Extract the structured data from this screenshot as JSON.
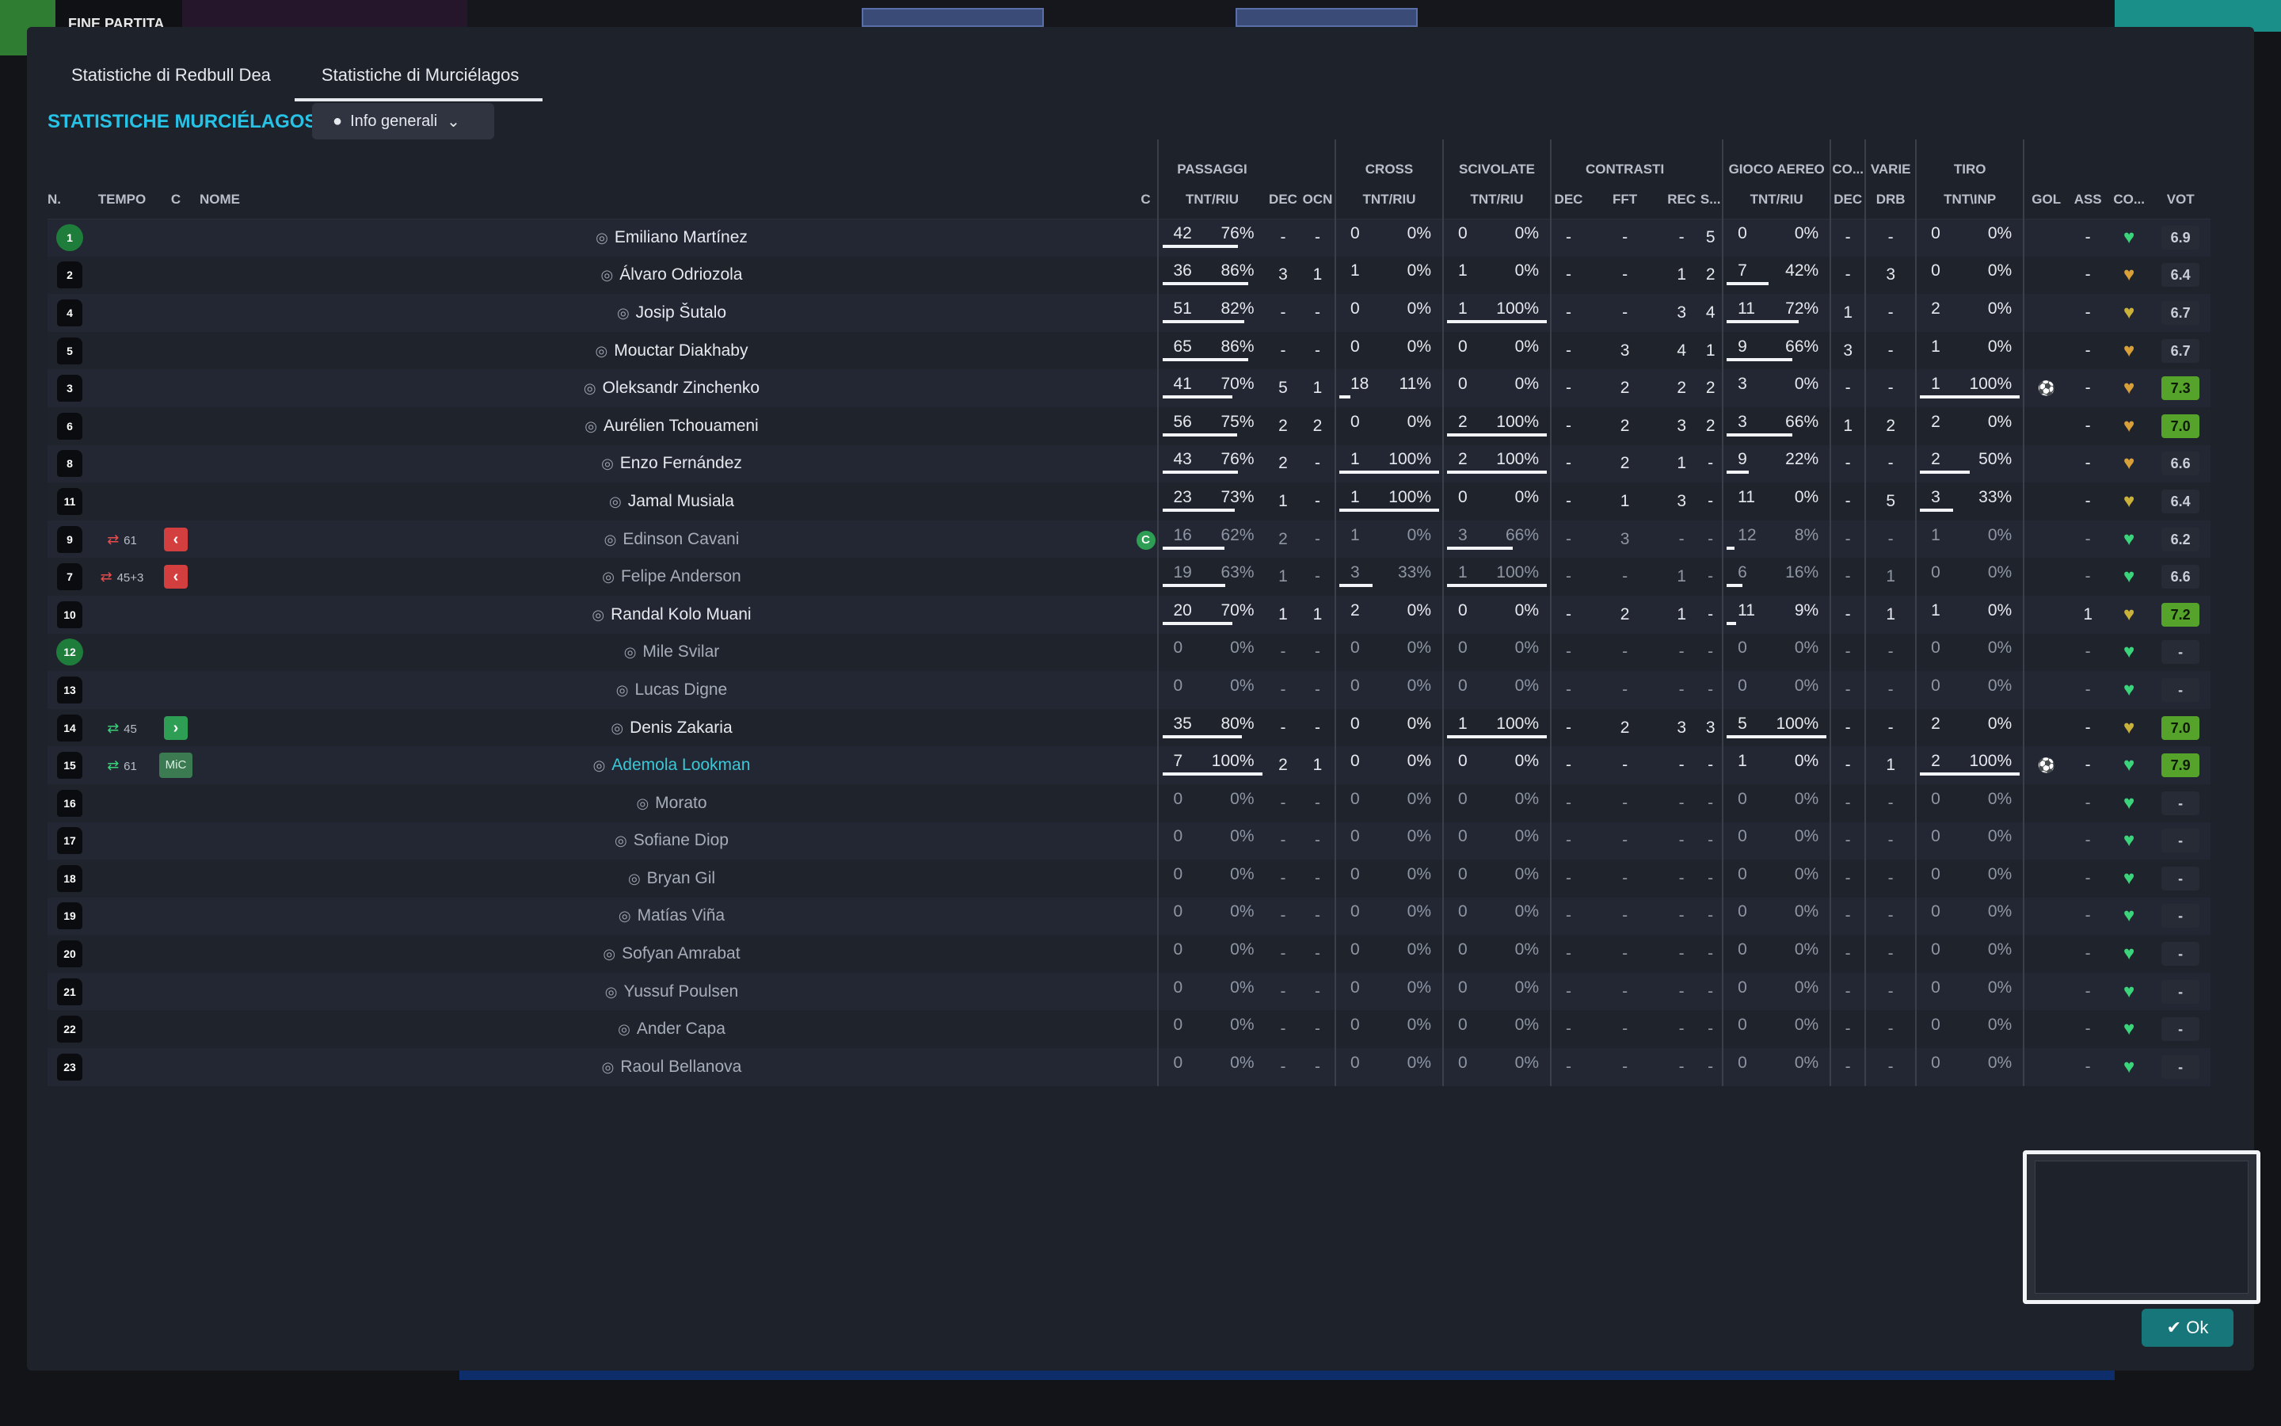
{
  "topbar": {
    "fine_partita": "FINE PARTITA"
  },
  "dialog": {
    "tabs": [
      "Statistiche di Redbull Dea",
      "Statistiche di Murciélagos"
    ],
    "title": "STATISTICHE MURCIÉLAGOS",
    "view": "Info generali",
    "ok": "Ok"
  },
  "groups": [
    "PASSAGGI",
    "CROSS",
    "SCIVOLATE",
    "CONTRASTI",
    "GIOCO AEREO",
    "CO...",
    "VARIE",
    "TIRO"
  ],
  "cols": [
    "N.",
    "TEMPO",
    "C",
    "NOME",
    "C",
    "TNT/RIU",
    "DEC",
    "OCN",
    "TNT/RIU",
    "TNT/RIU",
    "DEC",
    "FFT",
    "REC",
    "S...",
    "TNT/RIU",
    "DEC",
    "DRB",
    "TNT\\INP",
    "GOL",
    "ASS",
    "CO...",
    "VOT"
  ],
  "players": [
    {
      "n": "1",
      "gk": true,
      "name": "Emiliano Martínez",
      "pas": [
        "42",
        "76%",
        0.76
      ],
      "dec": "-",
      "ocn": "-",
      "cross": [
        "0",
        "0%",
        0
      ],
      "sciv": [
        "0",
        "0%",
        0
      ],
      "ct": [
        "-",
        "-",
        "-",
        "5"
      ],
      "aereo": [
        "0",
        "0%",
        0
      ],
      "co": "-",
      "drb": "-",
      "tiro": [
        "0",
        "0%",
        0
      ],
      "gol": "",
      "ass": "-",
      "cond": "g",
      "vot": "6.9",
      "vg": false
    },
    {
      "n": "2",
      "name": "Álvaro Odriozola",
      "pas": [
        "36",
        "86%",
        0.86
      ],
      "dec": "3",
      "ocn": "1",
      "cross": [
        "1",
        "0%",
        0
      ],
      "sciv": [
        "1",
        "0%",
        0
      ],
      "ct": [
        "-",
        "-",
        "1",
        "2"
      ],
      "aereo": [
        "7",
        "42%",
        0.42
      ],
      "co": "-",
      "drb": "3",
      "tiro": [
        "0",
        "0%",
        0
      ],
      "gol": "",
      "ass": "-",
      "cond": "o",
      "vot": "6.4",
      "vg": false
    },
    {
      "n": "4",
      "name": "Josip Šutalo",
      "pas": [
        "51",
        "82%",
        0.82
      ],
      "dec": "-",
      "ocn": "-",
      "cross": [
        "0",
        "0%",
        0
      ],
      "sciv": [
        "1",
        "100%",
        1
      ],
      "ct": [
        "-",
        "-",
        "3",
        "4"
      ],
      "aereo": [
        "11",
        "72%",
        0.72
      ],
      "co": "1",
      "drb": "-",
      "tiro": [
        "2",
        "0%",
        0
      ],
      "gol": "",
      "ass": "-",
      "cond": "y",
      "vot": "6.7",
      "vg": false
    },
    {
      "n": "5",
      "name": "Mouctar Diakhaby",
      "pas": [
        "65",
        "86%",
        0.86
      ],
      "dec": "-",
      "ocn": "-",
      "cross": [
        "0",
        "0%",
        0
      ],
      "sciv": [
        "0",
        "0%",
        0
      ],
      "ct": [
        "-",
        "3",
        "4",
        "1"
      ],
      "aereo": [
        "9",
        "66%",
        0.66
      ],
      "co": "3",
      "drb": "-",
      "tiro": [
        "1",
        "0%",
        0
      ],
      "gol": "",
      "ass": "-",
      "cond": "o",
      "vot": "6.7",
      "vg": false
    },
    {
      "n": "3",
      "name": "Oleksandr Zinchenko",
      "pas": [
        "41",
        "70%",
        0.7
      ],
      "dec": "5",
      "ocn": "1",
      "cross": [
        "18",
        "11%",
        0.11
      ],
      "sciv": [
        "0",
        "0%",
        0
      ],
      "ct": [
        "-",
        "2",
        "2",
        "2"
      ],
      "aereo": [
        "3",
        "0%",
        0
      ],
      "co": "-",
      "drb": "-",
      "tiro": [
        "1",
        "100%",
        1
      ],
      "gol": "⚽",
      "ass": "-",
      "cond": "o",
      "vot": "7.3",
      "vg": true
    },
    {
      "n": "6",
      "name": "Aurélien Tchouameni",
      "pas": [
        "56",
        "75%",
        0.75
      ],
      "dec": "2",
      "ocn": "2",
      "cross": [
        "0",
        "0%",
        0
      ],
      "sciv": [
        "2",
        "100%",
        1
      ],
      "ct": [
        "-",
        "2",
        "3",
        "2"
      ],
      "aereo": [
        "3",
        "66%",
        0.66
      ],
      "co": "1",
      "drb": "2",
      "tiro": [
        "2",
        "0%",
        0
      ],
      "gol": "",
      "ass": "-",
      "cond": "o",
      "vot": "7.0",
      "vg": true
    },
    {
      "n": "8",
      "name": "Enzo Fernández",
      "pas": [
        "43",
        "76%",
        0.76
      ],
      "dec": "2",
      "ocn": "-",
      "cross": [
        "1",
        "100%",
        1
      ],
      "sciv": [
        "2",
        "100%",
        1
      ],
      "ct": [
        "-",
        "2",
        "1",
        "-"
      ],
      "aereo": [
        "9",
        "22%",
        0.22
      ],
      "co": "-",
      "drb": "-",
      "tiro": [
        "2",
        "50%",
        0.5
      ],
      "gol": "",
      "ass": "-",
      "cond": "o",
      "vot": "6.6",
      "vg": false
    },
    {
      "n": "11",
      "name": "Jamal Musiala",
      "pas": [
        "23",
        "73%",
        0.73
      ],
      "dec": "1",
      "ocn": "-",
      "cross": [
        "1",
        "100%",
        1
      ],
      "sciv": [
        "0",
        "0%",
        0
      ],
      "ct": [
        "-",
        "1",
        "3",
        "-"
      ],
      "aereo": [
        "11",
        "0%",
        0
      ],
      "co": "-",
      "drb": "5",
      "tiro": [
        "3",
        "33%",
        0.33
      ],
      "gol": "",
      "ass": "-",
      "cond": "y",
      "vot": "6.4",
      "vg": false
    },
    {
      "n": "9",
      "dim": true,
      "swap": "out",
      "tempo": "61",
      "subic": "out",
      "capt": "C",
      "name": "Edinson Cavani",
      "pas": [
        "16",
        "62%",
        0.62
      ],
      "dec": "2",
      "ocn": "-",
      "cross": [
        "1",
        "0%",
        0
      ],
      "sciv": [
        "3",
        "66%",
        0.66
      ],
      "ct": [
        "-",
        "3",
        "-",
        "-"
      ],
      "aereo": [
        "12",
        "8%",
        0.08
      ],
      "co": "-",
      "drb": "-",
      "tiro": [
        "1",
        "0%",
        0
      ],
      "gol": "",
      "ass": "-",
      "cond": "g",
      "vot": "6.2",
      "vg": false
    },
    {
      "n": "7",
      "dim": true,
      "swap": "out",
      "tempo": "45+3",
      "subic": "out",
      "name": "Felipe Anderson",
      "pas": [
        "19",
        "63%",
        0.63
      ],
      "dec": "1",
      "ocn": "-",
      "cross": [
        "3",
        "33%",
        0.33
      ],
      "sciv": [
        "1",
        "100%",
        1
      ],
      "ct": [
        "-",
        "-",
        "1",
        "-"
      ],
      "aereo": [
        "6",
        "16%",
        0.16
      ],
      "co": "-",
      "drb": "1",
      "tiro": [
        "0",
        "0%",
        0
      ],
      "gol": "",
      "ass": "-",
      "cond": "g",
      "vot": "6.6",
      "vg": false
    },
    {
      "n": "10",
      "name": "Randal Kolo Muani",
      "pas": [
        "20",
        "70%",
        0.7
      ],
      "dec": "1",
      "ocn": "1",
      "cross": [
        "2",
        "0%",
        0
      ],
      "sciv": [
        "0",
        "0%",
        0
      ],
      "ct": [
        "-",
        "2",
        "1",
        "-"
      ],
      "aereo": [
        "11",
        "9%",
        0.09
      ],
      "co": "-",
      "drb": "1",
      "tiro": [
        "1",
        "0%",
        0
      ],
      "gol": "",
      "ass": "1",
      "cond": "y",
      "vot": "7.2",
      "vg": true
    },
    {
      "n": "12",
      "gk": true,
      "dim": true,
      "name": "Mile Svilar",
      "pas": [
        "0",
        "0%",
        0
      ],
      "dec": "-",
      "ocn": "-",
      "cross": [
        "0",
        "0%",
        0
      ],
      "sciv": [
        "0",
        "0%",
        0
      ],
      "ct": [
        "-",
        "-",
        "-",
        "-"
      ],
      "aereo": [
        "0",
        "0%",
        0
      ],
      "co": "-",
      "drb": "-",
      "tiro": [
        "0",
        "0%",
        0
      ],
      "gol": "",
      "ass": "-",
      "cond": "g",
      "vot": "-",
      "vg": false
    },
    {
      "n": "13",
      "dim": true,
      "name": "Lucas Digne",
      "pas": [
        "0",
        "0%",
        0
      ],
      "dec": "-",
      "ocn": "-",
      "cross": [
        "0",
        "0%",
        0
      ],
      "sciv": [
        "0",
        "0%",
        0
      ],
      "ct": [
        "-",
        "-",
        "-",
        "-"
      ],
      "aereo": [
        "0",
        "0%",
        0
      ],
      "co": "-",
      "drb": "-",
      "tiro": [
        "0",
        "0%",
        0
      ],
      "gol": "",
      "ass": "-",
      "cond": "g",
      "vot": "-",
      "vg": false
    },
    {
      "n": "14",
      "swap": "in",
      "tempo": "45",
      "subic": "in",
      "name": "Denis Zakaria",
      "pas": [
        "35",
        "80%",
        0.8
      ],
      "dec": "-",
      "ocn": "-",
      "cross": [
        "0",
        "0%",
        0
      ],
      "sciv": [
        "1",
        "100%",
        1
      ],
      "ct": [
        "-",
        "2",
        "3",
        "3"
      ],
      "aereo": [
        "5",
        "100%",
        1
      ],
      "co": "-",
      "drb": "-",
      "tiro": [
        "2",
        "0%",
        0
      ],
      "gol": "",
      "ass": "-",
      "cond": "y",
      "vot": "7.0",
      "vg": true
    },
    {
      "n": "15",
      "swap": "in",
      "tempo": "61",
      "pos": "MiC",
      "hl": true,
      "name": "Ademola Lookman",
      "pas": [
        "7",
        "100%",
        1
      ],
      "dec": "2",
      "ocn": "1",
      "cross": [
        "0",
        "0%",
        0
      ],
      "sciv": [
        "0",
        "0%",
        0
      ],
      "ct": [
        "-",
        "-",
        "-",
        "-"
      ],
      "aereo": [
        "1",
        "0%",
        0
      ],
      "co": "-",
      "drb": "1",
      "tiro": [
        "2",
        "100%",
        1
      ],
      "gol": "⚽",
      "ass": "-",
      "cond": "g",
      "vot": "7.9",
      "vg": true
    },
    {
      "n": "16",
      "dim": true,
      "name": "Morato",
      "pas": [
        "0",
        "0%",
        0
      ],
      "dec": "-",
      "ocn": "-",
      "cross": [
        "0",
        "0%",
        0
      ],
      "sciv": [
        "0",
        "0%",
        0
      ],
      "ct": [
        "-",
        "-",
        "-",
        "-"
      ],
      "aereo": [
        "0",
        "0%",
        0
      ],
      "co": "-",
      "drb": "-",
      "tiro": [
        "0",
        "0%",
        0
      ],
      "gol": "",
      "ass": "-",
      "cond": "g",
      "vot": "-",
      "vg": false
    },
    {
      "n": "17",
      "dim": true,
      "name": "Sofiane Diop",
      "pas": [
        "0",
        "0%",
        0
      ],
      "dec": "-",
      "ocn": "-",
      "cross": [
        "0",
        "0%",
        0
      ],
      "sciv": [
        "0",
        "0%",
        0
      ],
      "ct": [
        "-",
        "-",
        "-",
        "-"
      ],
      "aereo": [
        "0",
        "0%",
        0
      ],
      "co": "-",
      "drb": "-",
      "tiro": [
        "0",
        "0%",
        0
      ],
      "gol": "",
      "ass": "-",
      "cond": "g",
      "vot": "-",
      "vg": false
    },
    {
      "n": "18",
      "dim": true,
      "name": "Bryan Gil",
      "pas": [
        "0",
        "0%",
        0
      ],
      "dec": "-",
      "ocn": "-",
      "cross": [
        "0",
        "0%",
        0
      ],
      "sciv": [
        "0",
        "0%",
        0
      ],
      "ct": [
        "-",
        "-",
        "-",
        "-"
      ],
      "aereo": [
        "0",
        "0%",
        0
      ],
      "co": "-",
      "drb": "-",
      "tiro": [
        "0",
        "0%",
        0
      ],
      "gol": "",
      "ass": "-",
      "cond": "g",
      "vot": "-",
      "vg": false
    },
    {
      "n": "19",
      "dim": true,
      "name": "Matías Viña",
      "pas": [
        "0",
        "0%",
        0
      ],
      "dec": "-",
      "ocn": "-",
      "cross": [
        "0",
        "0%",
        0
      ],
      "sciv": [
        "0",
        "0%",
        0
      ],
      "ct": [
        "-",
        "-",
        "-",
        "-"
      ],
      "aereo": [
        "0",
        "0%",
        0
      ],
      "co": "-",
      "drb": "-",
      "tiro": [
        "0",
        "0%",
        0
      ],
      "gol": "",
      "ass": "-",
      "cond": "g",
      "vot": "-",
      "vg": false
    },
    {
      "n": "20",
      "dim": true,
      "name": "Sofyan Amrabat",
      "pas": [
        "0",
        "0%",
        0
      ],
      "dec": "-",
      "ocn": "-",
      "cross": [
        "0",
        "0%",
        0
      ],
      "sciv": [
        "0",
        "0%",
        0
      ],
      "ct": [
        "-",
        "-",
        "-",
        "-"
      ],
      "aereo": [
        "0",
        "0%",
        0
      ],
      "co": "-",
      "drb": "-",
      "tiro": [
        "0",
        "0%",
        0
      ],
      "gol": "",
      "ass": "-",
      "cond": "g",
      "vot": "-",
      "vg": false
    },
    {
      "n": "21",
      "dim": true,
      "name": "Yussuf Poulsen",
      "pas": [
        "0",
        "0%",
        0
      ],
      "dec": "-",
      "ocn": "-",
      "cross": [
        "0",
        "0%",
        0
      ],
      "sciv": [
        "0",
        "0%",
        0
      ],
      "ct": [
        "-",
        "-",
        "-",
        "-"
      ],
      "aereo": [
        "0",
        "0%",
        0
      ],
      "co": "-",
      "drb": "-",
      "tiro": [
        "0",
        "0%",
        0
      ],
      "gol": "",
      "ass": "-",
      "cond": "g",
      "vot": "-",
      "vg": false
    },
    {
      "n": "22",
      "dim": true,
      "name": "Ander Capa",
      "pas": [
        "0",
        "0%",
        0
      ],
      "dec": "-",
      "ocn": "-",
      "cross": [
        "0",
        "0%",
        0
      ],
      "sciv": [
        "0",
        "0%",
        0
      ],
      "ct": [
        "-",
        "-",
        "-",
        "-"
      ],
      "aereo": [
        "0",
        "0%",
        0
      ],
      "co": "-",
      "drb": "-",
      "tiro": [
        "0",
        "0%",
        0
      ],
      "gol": "",
      "ass": "-",
      "cond": "g",
      "vot": "-",
      "vg": false
    },
    {
      "n": "23",
      "dim": true,
      "name": "Raoul Bellanova",
      "pas": [
        "0",
        "0%",
        0
      ],
      "dec": "-",
      "ocn": "-",
      "cross": [
        "0",
        "0%",
        0
      ],
      "sciv": [
        "0",
        "0%",
        0
      ],
      "ct": [
        "-",
        "-",
        "-",
        "-"
      ],
      "aereo": [
        "0",
        "0%",
        0
      ],
      "co": "-",
      "drb": "-",
      "tiro": [
        "0",
        "0%",
        0
      ],
      "gol": "",
      "ass": "-",
      "cond": "g",
      "vot": "-",
      "vg": false
    }
  ]
}
